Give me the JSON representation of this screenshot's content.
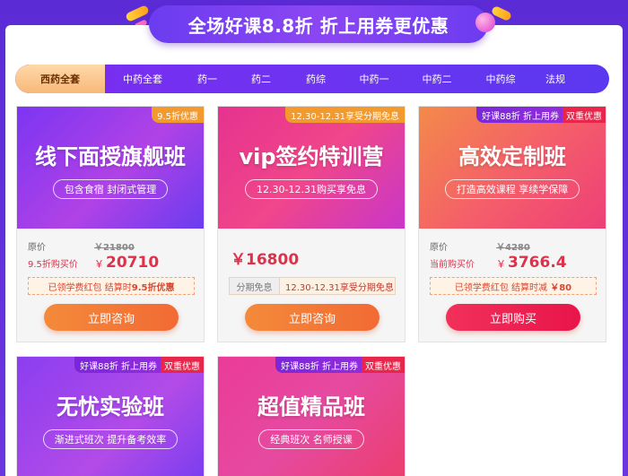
{
  "banner": {
    "text": "全场好课8.8折 折上用券更优惠"
  },
  "tabs": [
    {
      "label": "西药全套",
      "active": true
    },
    {
      "label": "中药全套"
    },
    {
      "label": "药一"
    },
    {
      "label": "药二"
    },
    {
      "label": "药综"
    },
    {
      "label": "中药一"
    },
    {
      "label": "中药二"
    },
    {
      "label": "中药综"
    },
    {
      "label": "法规"
    }
  ],
  "cards": [
    {
      "tag": "9.5折优惠",
      "title": "线下面授旗舰班",
      "subtitle": "包含食宿 封闭式管理",
      "orig_label": "原价",
      "orig_price": "￥21800",
      "now_label": "9.5折购买价",
      "currency": "￥",
      "now_price": "20710",
      "note_prefix": "已领学费红包 结算时",
      "note_bold": "9.5折优惠",
      "button": "立即咨询"
    },
    {
      "tag": "12.30-12.31享受分期免息",
      "title": "vip签约特训营",
      "subtitle": "12.30-12.31购买享免息",
      "price": "￥16800",
      "installment_key": "分期免息",
      "installment_val": "12.30-12.31享受分期免息",
      "button": "立即咨询"
    },
    {
      "tag": "好课88折 折上用券",
      "tag_red": "双重优惠",
      "title": "高效定制班",
      "subtitle": "打造高效课程 享续学保障",
      "orig_label": "原价",
      "orig_price": "￥4280",
      "now_label": "当前购买价",
      "currency": "￥",
      "now_price": "3766.4",
      "note_prefix": "已领学费红包 结算时减",
      "note_bold": "￥80",
      "button": "立即购买"
    },
    {
      "tag": "好课88折 折上用券",
      "tag_red": "双重优惠",
      "title": "无忧实验班",
      "subtitle": "渐进式班次 提升备考效率"
    },
    {
      "tag": "好课88折 折上用券",
      "tag_red": "双重优惠",
      "title": "超值精品班",
      "subtitle": "经典班次 名师授课"
    }
  ]
}
